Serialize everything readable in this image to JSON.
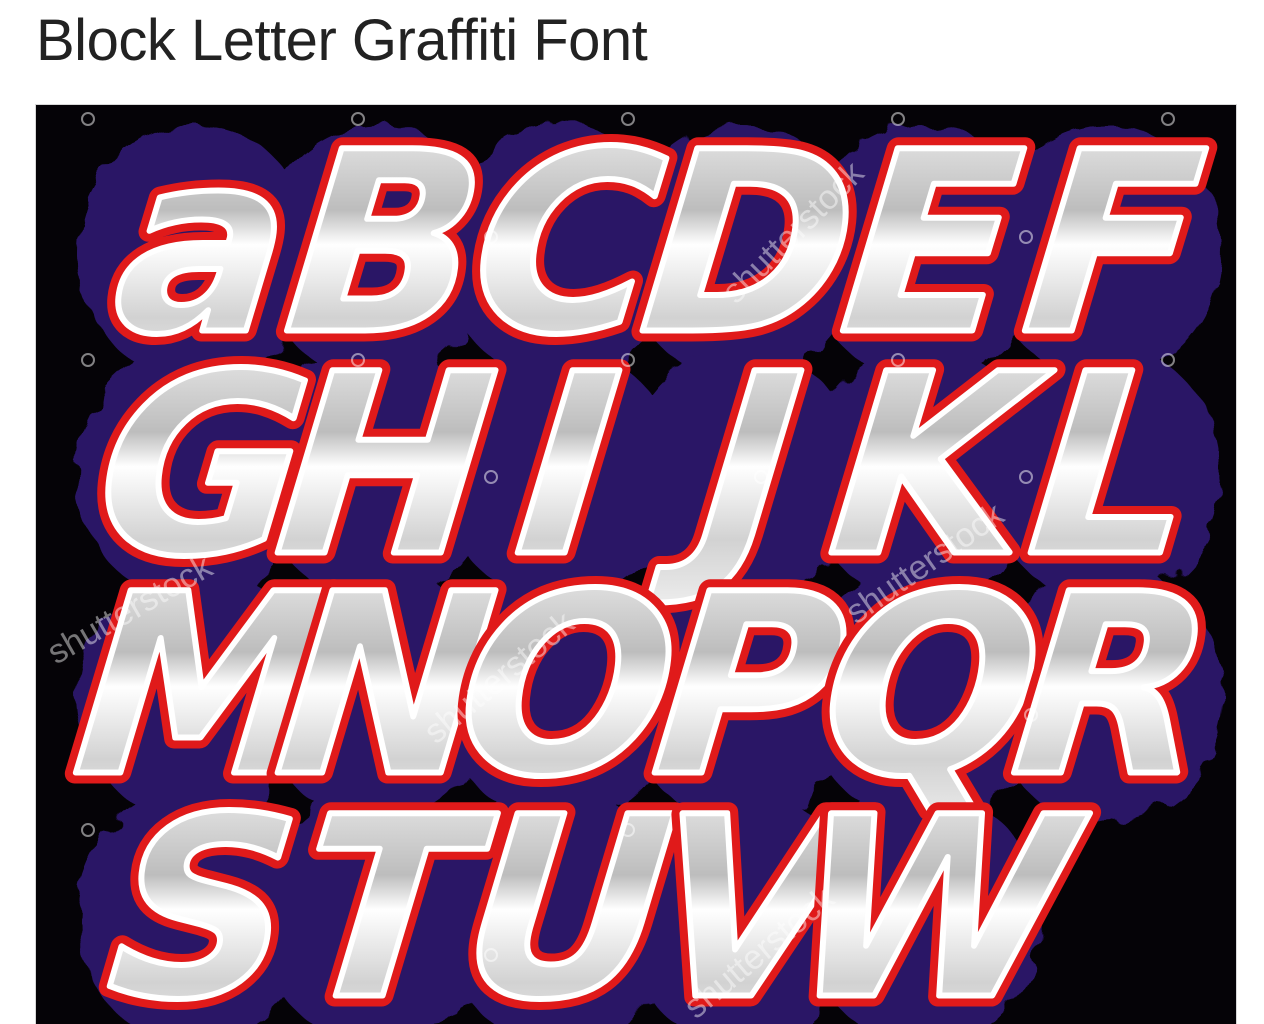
{
  "page": {
    "title": "Block Letter Graffiti Font"
  },
  "graffiti_image": {
    "rows": [
      [
        "a",
        "B",
        "C",
        "D",
        "E",
        "F"
      ],
      [
        "G",
        "H",
        "I",
        "J",
        "K",
        "L"
      ],
      [
        "M",
        "N",
        "O",
        "P",
        "Q",
        "R"
      ],
      [
        "S",
        "T",
        "U",
        "V",
        "W"
      ]
    ],
    "watermark_text": "shutterstock",
    "colors": {
      "background": "#050307",
      "outline_shadow": "#2b1766",
      "letter_outline": "#e01a1a",
      "letter_fill_light": "#ffffff",
      "letter_fill_mid": "#c8c8c8"
    }
  }
}
